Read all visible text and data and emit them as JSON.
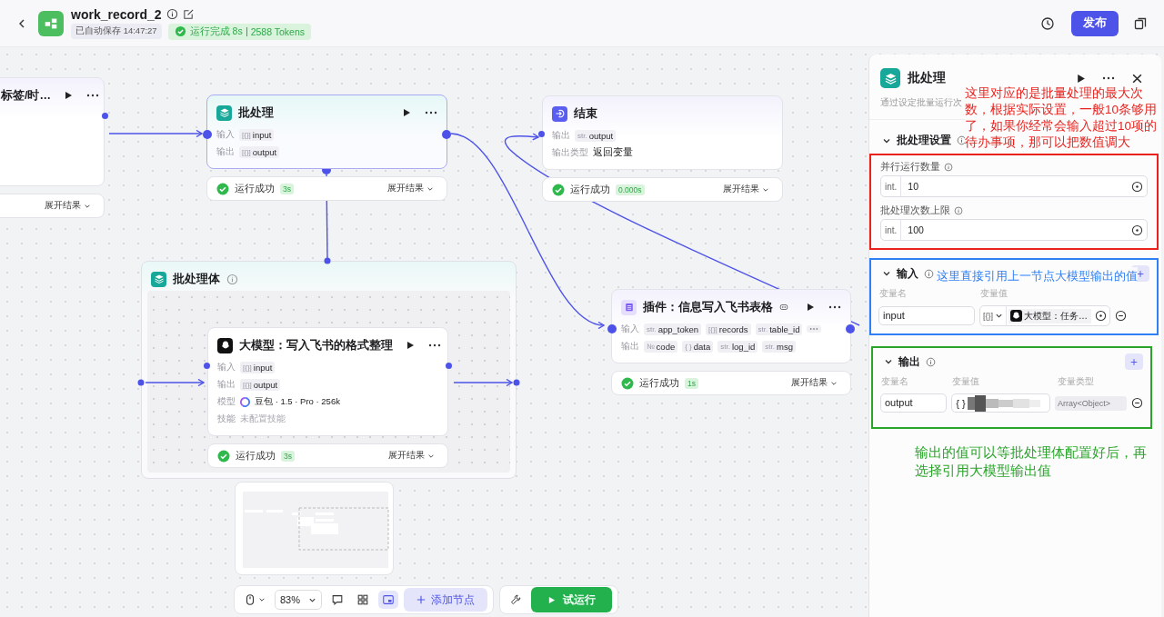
{
  "header": {
    "title": "work_record_2",
    "autosave": "已自动保存 14:47:27",
    "run_status": "运行完成 8s",
    "tokens": "2588 Tokens",
    "publish": "发布"
  },
  "canvas": {
    "nodes": [
      {
        "kind": "partial",
        "title": "标签/时…",
        "result": {
          "expand": "展开结果"
        }
      },
      {
        "kind": "batch",
        "title": "批处理",
        "rows": [
          {
            "label": "输入",
            "kind": "tags",
            "tags": [
              {
                "prefix": "[{}]",
                "name": "input"
              }
            ]
          },
          {
            "label": "输出",
            "kind": "tags",
            "tags": [
              {
                "prefix": "[{}]",
                "name": "output"
              }
            ]
          }
        ],
        "result": {
          "status": "运行成功",
          "duration": "3s",
          "expand": "展开结果"
        }
      },
      {
        "kind": "end",
        "title": "结束",
        "rows": [
          {
            "label": "输出",
            "kind": "tags",
            "tags": [
              {
                "prefix": "str.",
                "name": "output"
              }
            ]
          },
          {
            "label": "输出类型",
            "kind": "text",
            "value": "返回变量"
          }
        ],
        "result": {
          "status": "运行成功",
          "duration": "0.000s",
          "expand": "展开结果"
        }
      },
      {
        "kind": "plugin",
        "title": "插件：信息写入飞书表格",
        "rows": [
          {
            "label": "输入",
            "kind": "tags",
            "more": true,
            "tags": [
              {
                "prefix": "str.",
                "name": "app_token"
              },
              {
                "prefix": "[{}]",
                "name": "records"
              },
              {
                "prefix": "str.",
                "name": "table_id"
              }
            ]
          },
          {
            "label": "输出",
            "kind": "tags",
            "tags": [
              {
                "prefix": "№",
                "name": "code"
              },
              {
                "prefix": "{ }",
                "name": "data"
              },
              {
                "prefix": "str.",
                "name": "log_id"
              },
              {
                "prefix": "str.",
                "name": "msg"
              }
            ]
          }
        ],
        "result": {
          "status": "运行成功",
          "duration": "1s",
          "expand": "展开结果"
        }
      },
      {
        "kind": "llm",
        "title": "大模型：写入飞书的格式整理",
        "rows": [
          {
            "label": "输入",
            "kind": "tags",
            "tags": [
              {
                "prefix": "[{}]",
                "name": "input"
              }
            ]
          },
          {
            "label": "输出",
            "kind": "tags",
            "tags": [
              {
                "prefix": "[{}]",
                "name": "output"
              }
            ]
          },
          {
            "label": "模型",
            "kind": "model",
            "value": "豆包 · 1.5 · Pro · 256k"
          },
          {
            "label": "技能",
            "kind": "empty",
            "value": "未配置技能"
          }
        ],
        "result": {
          "status": "运行成功",
          "duration": "3s",
          "expand": "展开结果"
        }
      }
    ],
    "batch_body": {
      "title": "批处理体"
    },
    "toolbar": {
      "zoom": "83%",
      "minimap_selected": true,
      "add_node": "添加节点",
      "test_run": "试运行"
    }
  },
  "panel": {
    "title": "批处理",
    "description": "通过设定批量运行次",
    "settings": {
      "title": "批处理设置",
      "fields": [
        {
          "label": "并行运行数量",
          "type": "int.",
          "value": "10"
        },
        {
          "label": "批处理次数上限",
          "type": "int.",
          "value": "100"
        }
      ]
    },
    "input": {
      "title": "输入",
      "headers": [
        "变量名",
        "变量值"
      ],
      "rows": [
        {
          "name": "input",
          "type": "[{}]",
          "ref": "大模型：任务…"
        }
      ]
    },
    "output": {
      "title": "输出",
      "headers": [
        "变量名",
        "变量值",
        "变量类型"
      ],
      "rows": [
        {
          "name": "output",
          "prefix": "{ }",
          "type": "Array<Object>"
        }
      ]
    },
    "annotations": [
      {
        "text": "这里对应的是批量处理的最大次数，根据实际设置，一般10条够用了，如果你经常会输入超过10项的待办事项，那可以把数值调大",
        "color": "#e8231e"
      },
      {
        "text": "这里直接引用上一节点大模型输出的值",
        "color": "#2f7ff5"
      },
      {
        "text": "输出的值可以等批处理体配置好后，再选择引用大模型输出值",
        "color": "#2aa52a"
      }
    ]
  }
}
